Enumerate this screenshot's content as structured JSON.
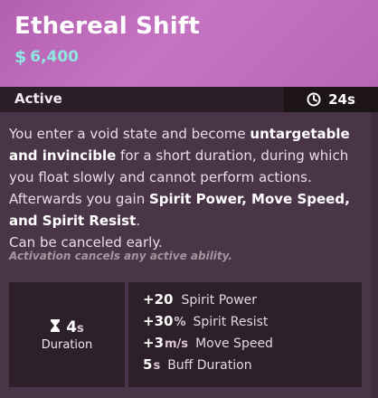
{
  "item": {
    "name": "Ethereal Shift",
    "cost_symbol": "$",
    "cost": "6,400",
    "type": "Active",
    "cooldown": "24s"
  },
  "description": {
    "p1": [
      {
        "text": "You enter a void state and become ",
        "bold": false
      },
      {
        "text": "untargetable and invincible",
        "bold": true
      },
      {
        "text": " for a short duration, during which you float slowly and cannot perform actions. Afterwards you gain ",
        "bold": false
      },
      {
        "text": "Spirit Power, Move Speed, and Spirit Resist",
        "bold": true
      },
      {
        "text": ".",
        "bold": false
      }
    ],
    "p2": "Can be canceled early.",
    "note": "Activation cancels any active ability."
  },
  "duration": {
    "value": "4",
    "unit": "s",
    "label": "Duration"
  },
  "bonuses": [
    {
      "value": "+20",
      "unit": "",
      "label": "Spirit Power"
    },
    {
      "value": "+30",
      "unit": "%",
      "label": "Spirit Resist"
    },
    {
      "value": "+3",
      "unit": "m/s",
      "label": "Move Speed"
    },
    {
      "value": "5",
      "unit": "s",
      "label": "Buff Duration"
    }
  ],
  "icons": {
    "cooldown": "clock-icon",
    "duration": "hourglass-icon",
    "cost": "souls-icon"
  },
  "colors": {
    "header": "#c574c2",
    "cost": "#8fe7e0",
    "panel": "#4a3447",
    "statbox": "#2e2029"
  }
}
